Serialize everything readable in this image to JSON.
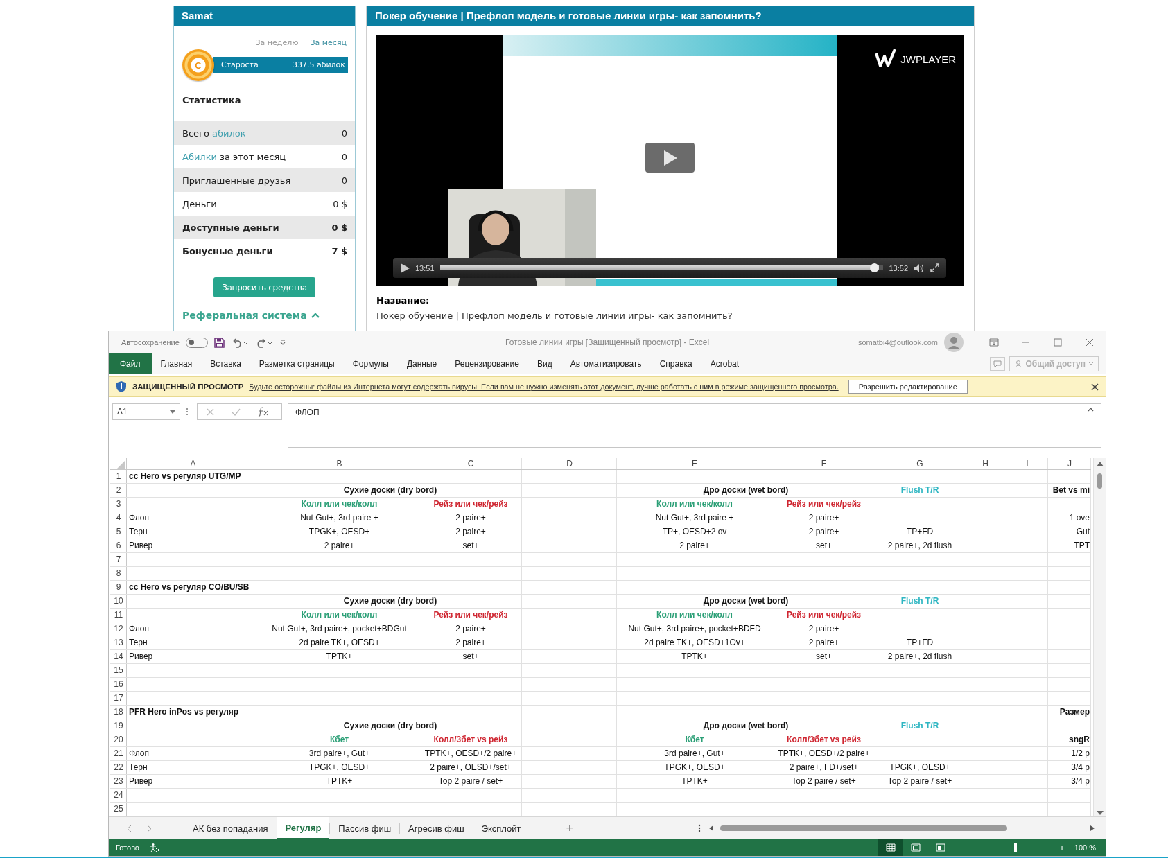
{
  "profile": {
    "title": "Samat",
    "periods": [
      {
        "label": "За неделю",
        "selected": false
      },
      {
        "label": "За месяц",
        "selected": true
      }
    ],
    "rank": {
      "badge": "C",
      "name": "Староста",
      "points": "337.5 абилок"
    },
    "stats_title": "Статистика",
    "stats": [
      {
        "parts": [
          {
            "text": "Всего ",
            "accent": false
          },
          {
            "text": "абилок",
            "accent": true
          }
        ],
        "value": "0",
        "strong": false
      },
      {
        "parts": [
          {
            "text": "Абилки",
            "accent": true
          },
          {
            "text": " за этот месяц",
            "accent": false
          }
        ],
        "value": "0",
        "strong": false
      },
      {
        "parts": [
          {
            "text": "Приглашенные друзья",
            "accent": false
          }
        ],
        "value": "0",
        "strong": false
      },
      {
        "parts": [
          {
            "text": "Деньги",
            "accent": false
          }
        ],
        "value": "0 $",
        "strong": false
      },
      {
        "parts": [
          {
            "text": "Доступные деньги",
            "accent": false
          }
        ],
        "value": "0 $",
        "strong": true
      },
      {
        "parts": [
          {
            "text": "Бонусные деньги",
            "accent": false
          }
        ],
        "value": "7 $",
        "strong": true
      }
    ],
    "request_button": "Запросить средства",
    "referral": {
      "label": "Реферальная система",
      "expanded": true
    }
  },
  "video": {
    "title": "Покер обучение | Префлоп модель и готовые линии игры- как запомнить?",
    "player_logo": "JWPLAYER",
    "elapsed": "13:51",
    "duration": "13:52",
    "progress": {
      "level": 0.99
    },
    "name_label": "Название:",
    "name_value": "Покер обучение | Префлоп модель и готовые линии игры- как запомнить?"
  },
  "excel": {
    "autosave": {
      "label": "Автосохранение",
      "on": false
    },
    "window_title": "Готовые линии игры [Защищенный просмотр] - Excel",
    "account": "somatbi4@outlook.com",
    "ribbon_tabs": [
      {
        "label": "Файл",
        "selected": true
      },
      {
        "label": "Главная",
        "selected": false
      },
      {
        "label": "Вставка",
        "selected": false
      },
      {
        "label": "Разметка страницы",
        "selected": false
      },
      {
        "label": "Формулы",
        "selected": false
      },
      {
        "label": "Данные",
        "selected": false
      },
      {
        "label": "Рецензирование",
        "selected": false
      },
      {
        "label": "Вид",
        "selected": false
      },
      {
        "label": "Автоматизировать",
        "selected": false
      },
      {
        "label": "Справка",
        "selected": false
      },
      {
        "label": "Acrobat",
        "selected": false
      }
    ],
    "share_button": {
      "label": "Общий доступ",
      "disabled": true
    },
    "protected_view": {
      "title": "ЗАЩИЩЕННЫЙ ПРОСМОТР",
      "message": "Будьте осторожны: файлы из Интернета могут содержать вирусы. Если вам не нужно изменять этот документ, лучше работать с ним в режиме защищенного просмотра.",
      "button": "Разрешить редактирование"
    },
    "name_box": "A1",
    "formula": "ФЛОП",
    "sheet": {
      "columns": [
        "A",
        "B",
        "C",
        "D",
        "E",
        "F",
        "G",
        "H",
        "I",
        "J"
      ],
      "rows": [
        {
          "number": "1",
          "cells": {
            "A": {
              "kind": "title",
              "text": "cc Hero vs регуляр UTG/MP"
            }
          }
        },
        {
          "number": "2",
          "cells": {
            "B": {
              "kind": "merged",
              "text": "Сухие доски (dry bord)"
            },
            "E": {
              "kind": "merged",
              "text": "Дро доски (wet bord)"
            },
            "G": {
              "kind": "heading",
              "text": "Flush T/R",
              "color": "#2eb6c2"
            },
            "J": {
              "kind": "edge-title",
              "text": "Bet vs mi"
            }
          }
        },
        {
          "number": "3",
          "cells": {
            "B": {
              "kind": "heading",
              "text": "Колл или чек/колл",
              "color": "#2b9f76"
            },
            "C": {
              "kind": "heading",
              "text": "Рейз или чек/рейз",
              "color": "#cf2631"
            },
            "E": {
              "kind": "heading",
              "text": "Колл или чек/колл",
              "color": "#2b9f76"
            },
            "F": {
              "kind": "heading",
              "text": "Рейз или чек/рейз",
              "color": "#cf2631"
            }
          }
        },
        {
          "number": "4",
          "cells": {
            "A": {
              "kind": "label",
              "text": "Флоп"
            },
            "B": {
              "kind": "value",
              "text": "Nut Gut+, 3rd paire +"
            },
            "C": {
              "kind": "value",
              "text": "2 paire+"
            },
            "E": {
              "kind": "value",
              "text": "Nut Gut+, 3rd paire +"
            },
            "F": {
              "kind": "value",
              "text": "2 paire+"
            },
            "J": {
              "kind": "edge",
              "text": "1 ove"
            }
          }
        },
        {
          "number": "5",
          "cells": {
            "A": {
              "kind": "label",
              "text": "Терн"
            },
            "B": {
              "kind": "value",
              "text": "TPGK+, OESD+"
            },
            "C": {
              "kind": "value",
              "text": "2 paire+"
            },
            "E": {
              "kind": "value",
              "text": "TP+, OESD+2 ov"
            },
            "F": {
              "kind": "value",
              "text": "2 paire+"
            },
            "G": {
              "kind": "value",
              "text": "TP+FD"
            },
            "J": {
              "kind": "edge",
              "text": "Gut"
            }
          }
        },
        {
          "number": "6",
          "cells": {
            "A": {
              "kind": "label",
              "text": "Ривер"
            },
            "B": {
              "kind": "value",
              "text": "2 paire+"
            },
            "C": {
              "kind": "value",
              "text": "set+"
            },
            "E": {
              "kind": "value",
              "text": "2 paire+"
            },
            "F": {
              "kind": "value",
              "text": "set+"
            },
            "G": {
              "kind": "value",
              "text": "2 paire+, 2d flush"
            },
            "J": {
              "kind": "edge",
              "text": "TPT"
            }
          }
        },
        {
          "number": "7"
        },
        {
          "number": "8"
        },
        {
          "number": "9",
          "cells": {
            "A": {
              "kind": "title",
              "text": "cc Hero vs регуляр CO/BU/SB"
            }
          }
        },
        {
          "number": "10",
          "cells": {
            "B": {
              "kind": "merged",
              "text": "Сухие доски (dry bord)"
            },
            "E": {
              "kind": "merged",
              "text": "Дро доски (wet bord)"
            },
            "G": {
              "kind": "heading",
              "text": "Flush T/R",
              "color": "#2eb6c2"
            }
          }
        },
        {
          "number": "11",
          "cells": {
            "B": {
              "kind": "heading",
              "text": "Колл или чек/колл",
              "color": "#2b9f76"
            },
            "C": {
              "kind": "heading",
              "text": "Рейз или чек/рейз",
              "color": "#cf2631"
            },
            "E": {
              "kind": "heading",
              "text": "Колл или чек/колл",
              "color": "#2b9f76"
            },
            "F": {
              "kind": "heading",
              "text": "Рейз или чек/рейз",
              "color": "#cf2631"
            }
          }
        },
        {
          "number": "12",
          "cells": {
            "A": {
              "kind": "label",
              "text": "Флоп"
            },
            "B": {
              "kind": "value",
              "text": "Nut Gut+, 3rd paire+, pocket+BDGut"
            },
            "C": {
              "kind": "value",
              "text": "2 paire+"
            },
            "E": {
              "kind": "value",
              "text": "Nut Gut+, 3rd paire+, pocket+BDFD"
            },
            "F": {
              "kind": "value",
              "text": "2 paire+"
            }
          }
        },
        {
          "number": "13",
          "cells": {
            "A": {
              "kind": "label",
              "text": "Терн"
            },
            "B": {
              "kind": "value",
              "text": "2d paire TK+, OESD+"
            },
            "C": {
              "kind": "value",
              "text": "2 paire+"
            },
            "E": {
              "kind": "value",
              "text": "2d paire TK+, OESD+1Ov+"
            },
            "F": {
              "kind": "value",
              "text": "2 paire+"
            },
            "G": {
              "kind": "value",
              "text": "TP+FD"
            }
          }
        },
        {
          "number": "14",
          "cells": {
            "A": {
              "kind": "label",
              "text": "Ривер"
            },
            "B": {
              "kind": "value",
              "text": "TPTK+"
            },
            "C": {
              "kind": "value",
              "text": "set+"
            },
            "E": {
              "kind": "value",
              "text": "TPTK+"
            },
            "F": {
              "kind": "value",
              "text": "set+"
            },
            "G": {
              "kind": "value",
              "text": "2 paire+, 2d flush"
            }
          }
        },
        {
          "number": "15"
        },
        {
          "number": "16"
        },
        {
          "number": "17"
        },
        {
          "number": "18",
          "cells": {
            "A": {
              "kind": "title",
              "text": "PFR Hero inPos vs регуляр"
            },
            "J": {
              "kind": "edge-title",
              "text": "Размер"
            }
          }
        },
        {
          "number": "19",
          "cells": {
            "B": {
              "kind": "merged",
              "text": "Сухие доски (dry bord)"
            },
            "E": {
              "kind": "merged",
              "text": "Дро доски (wet bord)"
            },
            "G": {
              "kind": "heading",
              "text": "Flush T/R",
              "color": "#2eb6c2"
            }
          }
        },
        {
          "number": "20",
          "cells": {
            "B": {
              "kind": "heading",
              "text": "Кбет",
              "color": "#2b9f76"
            },
            "C": {
              "kind": "heading",
              "text": "Колл/3бет vs рейз",
              "color": "#cf2631"
            },
            "E": {
              "kind": "heading",
              "text": "Кбет",
              "color": "#2b9f76"
            },
            "F": {
              "kind": "heading",
              "text": "Колл/3бет vs рейз",
              "color": "#cf2631"
            },
            "J": {
              "kind": "edge-title",
              "text": "sngR"
            }
          }
        },
        {
          "number": "21",
          "cells": {
            "A": {
              "kind": "label",
              "text": "Флоп"
            },
            "B": {
              "kind": "value",
              "text": "3rd paire+, Gut+"
            },
            "C": {
              "kind": "value",
              "text": "TPTK+, OESD+/2 paire+"
            },
            "E": {
              "kind": "value",
              "text": "3rd paire+, Gut+"
            },
            "F": {
              "kind": "value",
              "text": "TPTK+, OESD+/2 paire+"
            },
            "J": {
              "kind": "edge",
              "text": "1/2 p"
            }
          }
        },
        {
          "number": "22",
          "cells": {
            "A": {
              "kind": "label",
              "text": "Терн"
            },
            "B": {
              "kind": "value",
              "text": "TPGK+, OESD+"
            },
            "C": {
              "kind": "value",
              "text": "2 paire+, OESD+/set+"
            },
            "E": {
              "kind": "value",
              "text": "TPGK+, OESD+"
            },
            "F": {
              "kind": "value",
              "text": "2 paire+, FD+/set+"
            },
            "G": {
              "kind": "value",
              "text": "TPGK+, OESD+"
            },
            "J": {
              "kind": "edge",
              "text": "3/4 p"
            }
          }
        },
        {
          "number": "23",
          "cells": {
            "A": {
              "kind": "label",
              "text": "Ривер"
            },
            "B": {
              "kind": "value",
              "text": "TPTK+"
            },
            "C": {
              "kind": "value",
              "text": "Top 2 paire / set+"
            },
            "E": {
              "kind": "value",
              "text": "TPTK+"
            },
            "F": {
              "kind": "value",
              "text": "Top 2 paire / set+"
            },
            "G": {
              "kind": "value",
              "text": "Top 2 paire / set+"
            },
            "J": {
              "kind": "edge",
              "text": "3/4 p"
            }
          }
        },
        {
          "number": "24"
        },
        {
          "number": "25"
        }
      ]
    },
    "sheet_tabs": [
      {
        "label": "АК без попадания",
        "selected": false
      },
      {
        "label": "Регуляр",
        "selected": true
      },
      {
        "label": "Пассив фиш",
        "selected": false
      },
      {
        "label": "Агресив фиш",
        "selected": false
      },
      {
        "label": "Эксплойт",
        "selected": false
      }
    ],
    "add_sheet": "+",
    "status": "Готово",
    "views": [
      {
        "kind": "normal",
        "selected": true
      },
      {
        "kind": "page-layout",
        "selected": false
      },
      {
        "kind": "page-break",
        "selected": false
      }
    ],
    "zoom": {
      "out": "−",
      "in": "+",
      "level": 0.5,
      "label": "100 %"
    }
  }
}
